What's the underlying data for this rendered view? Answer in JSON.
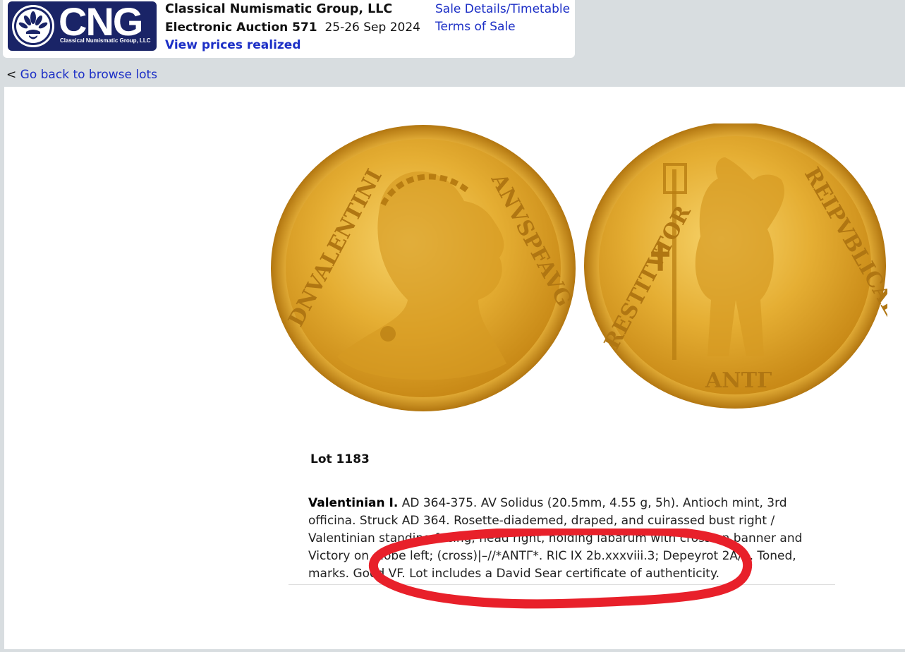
{
  "header": {
    "logo_text": "CNG",
    "logo_subtext": "Classical Numismatic Group, LLC",
    "company": "Classical Numismatic Group, LLC",
    "auction_name": "Electronic Auction 571",
    "auction_dates": "25-26 Sep 2024",
    "view_prices": "View prices realized",
    "sale_details": "Sale Details/Timetable",
    "terms": "Terms of Sale"
  },
  "nav": {
    "back_prefix": "<",
    "back_link": "Go back to browse lots"
  },
  "coin": {
    "obverse_legend_left": "DNVALENTINI",
    "obverse_legend_right": "ANVSPFAVG",
    "reverse_legend_left": "RESTITVTOR",
    "reverse_legend_right": "REIPVBLICAE",
    "reverse_exergue": "ANTΓ"
  },
  "lot": {
    "title": "Lot 1183",
    "ruler": "Valentinian I.",
    "description": "AD 364-375. AV Solidus (20.5mm, 4.55 g, 5h). Antioch mint, 3rd officina. Struck AD 364. Rosette-diademed, draped, and cuirassed bust right / Valentinian standing facing, head right, holding labarum with cross on banner and Victory on globe left; (cross)|–//*ANTΓ*. RIC IX 2b.xxxviii.3; Depeyrot 2A/1. Toned, marks. Good VF. Lot includes a David Sear certificate of authenticity."
  },
  "colors": {
    "link": "#1c2fc6",
    "logo_bg": "#1a2467",
    "page_bg": "#d8dde0",
    "gold": "#e8b33a",
    "annotation": "#e8202a"
  }
}
